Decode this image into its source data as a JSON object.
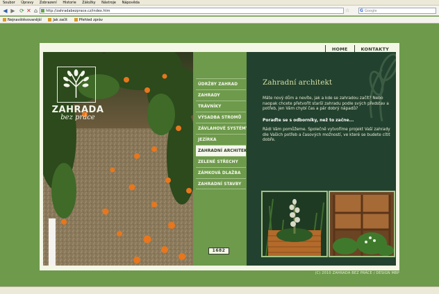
{
  "browser": {
    "menu": [
      "Soubor",
      "Úpravy",
      "Zobrazení",
      "Historie",
      "Záložky",
      "Nástroje",
      "Nápověda"
    ],
    "url": "http://zahradabezprace.cz/index.htm",
    "search_placeholder": "Google",
    "search_engine_letter": "G",
    "bookmarks": [
      "Nejnavštěvovanější",
      "Jak začít",
      "Přehled zpráv"
    ]
  },
  "site": {
    "nav": [
      "HOME",
      "KONTAKTY"
    ],
    "logo": {
      "name": "ZAHRADA",
      "tagline": "bez práce"
    },
    "menu": [
      "Údržby zahrad",
      "Zahrady",
      "Trávníky",
      "Výsadba stromů",
      "Závlahové systémy",
      "Jezírka",
      "Zahradní architekt",
      "Zelené střechy",
      "Zámková dlažba",
      "Zahradní stavby"
    ],
    "active_menu_index": 6,
    "counter": "1682",
    "content": {
      "title": "Zahradní architekt",
      "paragraph1": "Máte nový dům a nevíte, jak a kde se zahradou začít? Nebo naopak chcete přetvořit starší zahradu podle svých představ a potřeb, jen Vám chybí čas a pár dobrý nápadů?",
      "highlight": "Poraďte se s odborníky, než to začne...",
      "paragraph2": "Rádi Vám pomůžeme. Společně vytvoříme projekt Vaší zahrady dle Vašich potřeb a časových možností, ve které se budete cítit dobře."
    },
    "copyright": "(C) 2010 ZAHRADA BEZ PRÁCE / DESIGN MBP"
  },
  "colors": {
    "background": "#6d9a4b",
    "content_panel": "#22412e",
    "title": "#d4dea6",
    "frame": "#f4f6e6"
  }
}
